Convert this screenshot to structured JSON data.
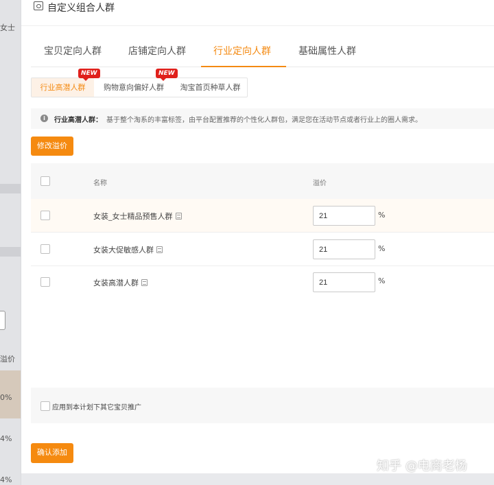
{
  "background": {
    "frag1": "女士",
    "frag2": "溢价",
    "frag3": "0%",
    "frag4": "4%",
    "frag5": "4%"
  },
  "modal": {
    "title": "自定义组合人群"
  },
  "tabs": [
    {
      "label": "宝贝定向人群"
    },
    {
      "label": "店铺定向人群"
    },
    {
      "label": "行业定向人群"
    },
    {
      "label": "基础属性人群"
    }
  ],
  "subtabs": [
    {
      "label": "行业高潜人群",
      "badge": "NEW"
    },
    {
      "label": "购物意向偏好人群",
      "badge": "NEW"
    },
    {
      "label": "淘宝首页种草人群"
    }
  ],
  "notice": {
    "label": "行业高潜人群：",
    "text": "基于整个淘系的丰富标签，由平台配置推荐的个性化人群包，满足您在活动节点或者行业上的圈人需求。"
  },
  "edit_button": "修改溢价",
  "table": {
    "columns": [
      "名称",
      "溢价"
    ],
    "rows": [
      {
        "name": "女装_女士精品预售人群",
        "price": "21",
        "unit": "%"
      },
      {
        "name": "女装大促敏感人群",
        "price": "21",
        "unit": "%"
      },
      {
        "name": "女装高潜人群",
        "price": "21",
        "unit": "%"
      }
    ]
  },
  "apply_label": "应用到本计划下其它宝贝推广",
  "confirm_button": "确认添加",
  "watermark": "知乎 @电商老杨",
  "colors": {
    "accent": "#f58a10",
    "badge": "#e0201b"
  }
}
